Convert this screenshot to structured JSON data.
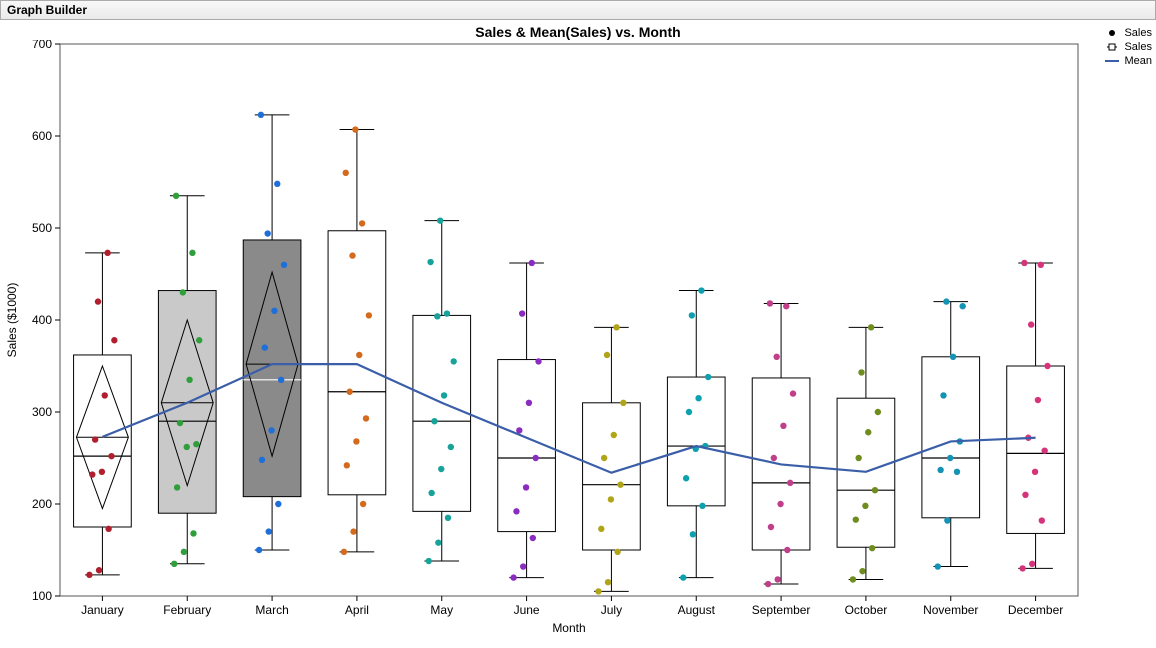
{
  "window": {
    "title": "Graph Builder"
  },
  "chart": {
    "title": "Sales & Mean(Sales) vs. Month"
  },
  "axes": {
    "y_label": "Sales ($1000)",
    "x_label": "Month"
  },
  "legend": {
    "points": "Sales",
    "box": "Sales",
    "line": "Mean"
  },
  "chart_data": {
    "type": "boxplot-with-points-and-mean-line",
    "ylabel": "Sales ($1000)",
    "xlabel": "Month",
    "title": "Sales & Mean(Sales) vs. Month",
    "ylim": [
      100,
      700
    ],
    "y_ticks": [
      100,
      200,
      300,
      400,
      500,
      600,
      700
    ],
    "categories": [
      "January",
      "February",
      "March",
      "April",
      "May",
      "June",
      "July",
      "August",
      "September",
      "October",
      "November",
      "December"
    ],
    "boxes": [
      {
        "q1": 175,
        "median": 252,
        "q3": 362,
        "whisker_low": 123,
        "whisker_high": 473,
        "fill": "#ffffff",
        "diamond_low": 195,
        "diamond_high": 350
      },
      {
        "q1": 190,
        "median": 290,
        "q3": 432,
        "whisker_low": 135,
        "whisker_high": 535,
        "fill": "#c9c9c9",
        "diamond_low": 220,
        "diamond_high": 400
      },
      {
        "q1": 208,
        "median": 335,
        "q3": 487,
        "whisker_low": 150,
        "whisker_high": 623,
        "fill": "#8a8a8a",
        "diamond_low": 252,
        "diamond_high": 452,
        "median_white": true
      },
      {
        "q1": 210,
        "median": 322,
        "q3": 497,
        "whisker_low": 148,
        "whisker_high": 607,
        "fill": "#ffffff"
      },
      {
        "q1": 192,
        "median": 290,
        "q3": 405,
        "whisker_low": 138,
        "whisker_high": 508,
        "fill": "#ffffff"
      },
      {
        "q1": 170,
        "median": 250,
        "q3": 357,
        "whisker_low": 120,
        "whisker_high": 462,
        "fill": "#ffffff"
      },
      {
        "q1": 150,
        "median": 221,
        "q3": 310,
        "whisker_low": 105,
        "whisker_high": 392,
        "fill": "#ffffff"
      },
      {
        "q1": 198,
        "median": 263,
        "q3": 338,
        "whisker_low": 120,
        "whisker_high": 432,
        "fill": "#ffffff"
      },
      {
        "q1": 150,
        "median": 223,
        "q3": 337,
        "whisker_low": 113,
        "whisker_high": 418,
        "fill": "#ffffff"
      },
      {
        "q1": 153,
        "median": 215,
        "q3": 315,
        "whisker_low": 118,
        "whisker_high": 392,
        "fill": "#ffffff"
      },
      {
        "q1": 185,
        "median": 250,
        "q3": 360,
        "whisker_low": 132,
        "whisker_high": 420,
        "fill": "#ffffff"
      },
      {
        "q1": 168,
        "median": 255,
        "q3": 350,
        "whisker_low": 130,
        "whisker_high": 462,
        "fill": "#ffffff"
      }
    ],
    "mean_line": [
      273,
      310,
      352,
      352,
      310,
      272,
      234,
      263,
      243,
      235,
      268,
      272
    ],
    "points": {
      "January": {
        "color": "#b01f2e",
        "values": [
          123,
          128,
          173,
          232,
          235,
          252,
          270,
          318,
          378,
          420,
          473
        ]
      },
      "February": {
        "color": "#2e9f3a",
        "values": [
          135,
          148,
          168,
          218,
          262,
          265,
          288,
          335,
          378,
          430,
          473,
          535
        ]
      },
      "March": {
        "color": "#1f6fd8",
        "values": [
          150,
          170,
          200,
          248,
          280,
          335,
          370,
          410,
          460,
          494,
          548,
          623
        ]
      },
      "April": {
        "color": "#d46a1e",
        "values": [
          148,
          170,
          200,
          242,
          268,
          293,
          322,
          362,
          405,
          470,
          505,
          560,
          607
        ]
      },
      "May": {
        "color": "#17a39a",
        "values": [
          138,
          158,
          185,
          212,
          238,
          262,
          290,
          318,
          355,
          404,
          407,
          463,
          508
        ]
      },
      "June": {
        "color": "#8a2cbf",
        "values": [
          120,
          132,
          163,
          192,
          218,
          250,
          280,
          310,
          355,
          407,
          462
        ]
      },
      "July": {
        "color": "#b0a518",
        "values": [
          105,
          115,
          148,
          173,
          205,
          221,
          250,
          275,
          310,
          362,
          392
        ]
      },
      "August": {
        "color": "#0ea0ae",
        "values": [
          120,
          167,
          198,
          228,
          260,
          263,
          300,
          315,
          338,
          405,
          432
        ]
      },
      "September": {
        "color": "#c03f8a",
        "values": [
          113,
          118,
          150,
          175,
          200,
          223,
          250,
          285,
          320,
          360,
          415,
          418
        ]
      },
      "October": {
        "color": "#6f8c1f",
        "values": [
          118,
          127,
          152,
          183,
          198,
          215,
          250,
          278,
          300,
          343,
          392
        ]
      },
      "November": {
        "color": "#1593b5",
        "values": [
          132,
          182,
          235,
          237,
          250,
          268,
          318,
          360,
          415,
          420
        ]
      },
      "December": {
        "color": "#d6347a",
        "values": [
          130,
          135,
          182,
          210,
          235,
          258,
          272,
          313,
          350,
          395,
          460,
          462
        ]
      }
    }
  }
}
